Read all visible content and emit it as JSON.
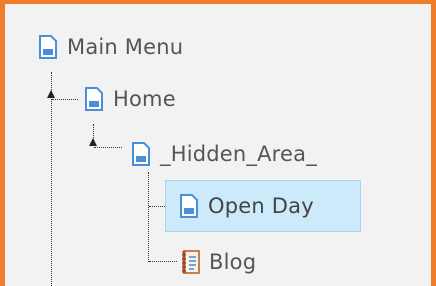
{
  "tree": {
    "nodes": [
      {
        "label": "Main Menu",
        "icon": "page-icon"
      },
      {
        "label": "Home",
        "icon": "page-icon"
      },
      {
        "label": "_Hidden_Area_",
        "icon": "page-icon"
      },
      {
        "label": "Open Day",
        "icon": "page-icon",
        "selected": true
      },
      {
        "label": "Blog",
        "icon": "blog-notebook-icon"
      }
    ]
  },
  "colors": {
    "frame_border": "#ef7d2c",
    "background": "#f2f2f2",
    "selection": "#cdeafb",
    "page_icon": "#4a90d9"
  }
}
